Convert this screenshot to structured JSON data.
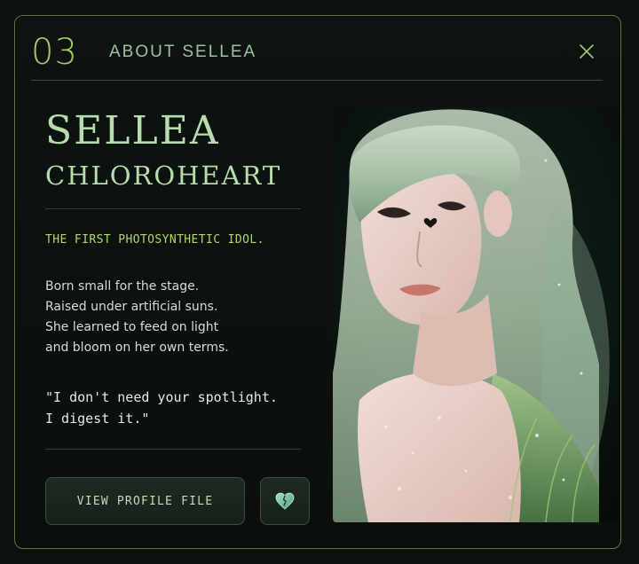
{
  "header": {
    "index": "03",
    "title": "ABOUT SELLEA",
    "close_icon": "close-icon"
  },
  "profile": {
    "name_first": "SELLEA",
    "name_last": "CHLOROHEART",
    "tagline": "THE FIRST PHOTOSYNTHETIC IDOL.",
    "bio_lines": [
      "Born small for the stage.",
      "Raised under artificial suns.",
      "She learned to feed on light",
      "and bloom on her own terms."
    ],
    "quote_lines": [
      "\"I don't need your spotlight.",
      "I digest it.\""
    ]
  },
  "actions": {
    "view_profile_label": "VIEW PROFILE FILE",
    "favorite_icon": "heart-icon"
  },
  "colors": {
    "accent": "#a8c66a",
    "border": "#5f7a3f",
    "text_mint": "#b7dcae",
    "tagline": "#b3d66b",
    "background": "#0b120d"
  }
}
